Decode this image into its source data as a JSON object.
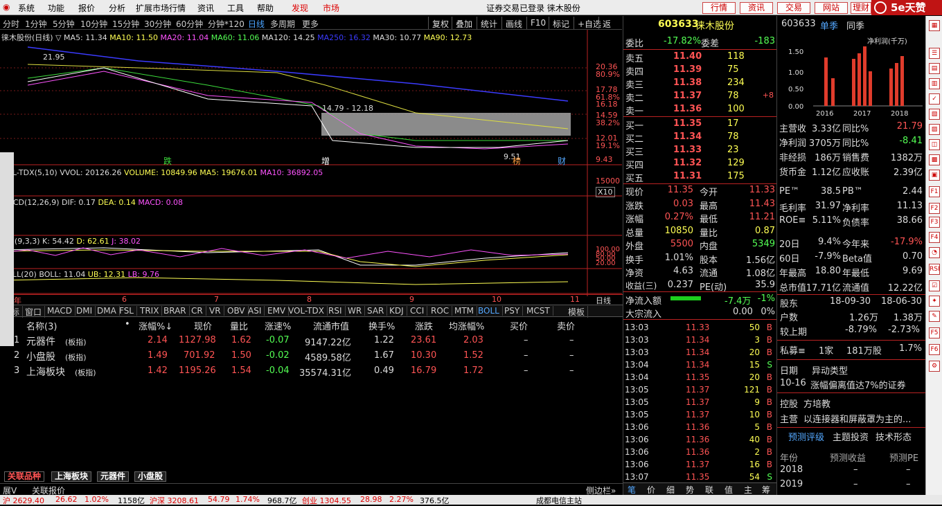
{
  "menubar": {
    "items": [
      "系统",
      "功能",
      "报价",
      "分析",
      "扩展市场行情",
      "资讯",
      "工具",
      "帮助",
      "发现",
      "市场"
    ],
    "center": "证券交易已登录 徕木股份",
    "buttons": [
      "行情",
      "资讯",
      "交易",
      "网站",
      "理财"
    ],
    "logo": "5e天赞"
  },
  "chart_toolbar": {
    "periods": [
      "分时",
      "1分钟",
      "5分钟",
      "10分钟",
      "15分钟",
      "30分钟",
      "60分钟",
      "分钟*120",
      "日线",
      "多周期",
      "更多"
    ],
    "selected": "日线",
    "actions": [
      "复权",
      "叠加",
      "统计",
      "画线",
      "F10",
      "标记",
      "+自选",
      "返回"
    ]
  },
  "ma_line": {
    "title": "徕木股份(日线) ▽",
    "ma5": "MA5: 11.34",
    "ma10": "MA10: 11.50",
    "ma20": "MA20: 11.04",
    "ma60": "MA60: 11.06",
    "ma120": "MA120: 14.25",
    "ma250": "MA250: 16.32",
    "ma30": "MA30: 10.77",
    "ma90": "MA90: 12.73"
  },
  "price_axis": [
    "20.36",
    "80.9%",
    "17.78",
    "61.8%",
    "16.18",
    "14.59",
    "38.2%",
    "12.01",
    "19.1%",
    "9.43"
  ],
  "price_marks": {
    "high": "21.95",
    "range": "14.79 - 12.18",
    "low": "9.51",
    "tags": [
      "跌",
      "增",
      "榜",
      "财"
    ]
  },
  "vol_line": {
    "title": "VOL-TDX(5,10)",
    "vvol": "VVOL: 20126.26",
    "volume": "VOLUME: 10849.96",
    "ma5": "MA5: 19676.01",
    "ma10": "MA10: 36892.05",
    "axis": "15000",
    "unit": "X10"
  },
  "macd_line": {
    "title": "MACD(12,26,9)",
    "dif": "DIF: 0.17",
    "dea": "DEA: 0.14",
    "macd": "MACD: 0.08"
  },
  "kdj_line": {
    "title": "KDJ(9,3,3)",
    "k": "K: 54.42",
    "d": "D: 62.61",
    "j": "J: 38.02",
    "axis": [
      "100.00",
      "80.00",
      "50.00",
      "20.00"
    ]
  },
  "boll_line": {
    "title": "BOLL(20)",
    "boll": "BOLL: 11.04",
    "ub": "UB: 12.31",
    "lb": "LB: 9.76"
  },
  "date_axis": [
    "18年",
    "6",
    "7",
    "8",
    "9",
    "10",
    "11"
  ],
  "date_period": "日线",
  "indicator_tabs": [
    "指标",
    "窗口",
    "MACD",
    "DMI",
    "DMA",
    "FSL",
    "TRIX",
    "BRAR",
    "CR",
    "VR",
    "OBV",
    "ASI",
    "EMV",
    "VOL-TDX",
    "RSI",
    "WR",
    "SAR",
    "KDJ",
    "CCI",
    "ROC",
    "MTM",
    "BOLL",
    "PSY",
    "MCST"
  ],
  "indicator_extra": "模板",
  "table": {
    "headers": [
      "名称(3)",
      "•",
      "涨幅%↓",
      "现价",
      "量比",
      "涨速%",
      "流通市值",
      "换手%",
      "涨跌",
      "均涨幅%",
      "买价",
      "卖价"
    ],
    "rows": [
      {
        "no": "1",
        "name": "元器件",
        "tag": "(板指)",
        "pct": "2.14",
        "price": "1127.98",
        "vr": "1.62",
        "speed": "-0.07",
        "mv": "9147.22亿",
        "turn": "1.22",
        "chg": "23.61",
        "avg": "2.03",
        "bid": "–",
        "ask": "–"
      },
      {
        "no": "2",
        "name": "小盘股",
        "tag": "(板指)",
        "pct": "1.49",
        "price": "701.92",
        "vr": "1.50",
        "speed": "-0.02",
        "mv": "4589.58亿",
        "turn": "1.67",
        "chg": "10.30",
        "avg": "1.52",
        "bid": "–",
        "ask": "–"
      },
      {
        "no": "3",
        "name": "上海板块",
        "tag": "(板指)",
        "pct": "1.42",
        "price": "1195.26",
        "vr": "1.54",
        "speed": "-0.04",
        "mv": "35574.31亿",
        "turn": "0.49",
        "chg": "16.79",
        "avg": "1.72",
        "bid": "–",
        "ask": "–"
      }
    ]
  },
  "sheets": [
    "关联品种",
    "上海板块",
    "元器件",
    "小盘股"
  ],
  "infobar": [
    "展V",
    "关联报价"
  ],
  "infobar_right": "侧边栏»",
  "quote": {
    "code": "603633",
    "name": "徕木股份",
    "wb_label": "委比",
    "wb": "-17.82%",
    "wc_label": "委差",
    "wc": "-183",
    "asks": [
      {
        "l": "卖五",
        "p": "11.40",
        "v": "118"
      },
      {
        "l": "卖四",
        "p": "11.39",
        "v": "75"
      },
      {
        "l": "卖三",
        "p": "11.38",
        "v": "234"
      },
      {
        "l": "卖二",
        "p": "11.37",
        "v": "78",
        "x": "+8"
      },
      {
        "l": "卖一",
        "p": "11.36",
        "v": "100"
      }
    ],
    "bids": [
      {
        "l": "买一",
        "p": "11.35",
        "v": "17"
      },
      {
        "l": "买二",
        "p": "11.34",
        "v": "78"
      },
      {
        "l": "买三",
        "p": "11.33",
        "v": "23"
      },
      {
        "l": "买四",
        "p": "11.32",
        "v": "129"
      },
      {
        "l": "买五",
        "p": "11.31",
        "v": "175"
      }
    ],
    "stats": [
      [
        "现价",
        "11.35",
        "今开",
        "11.33"
      ],
      [
        "涨跌",
        "0.03",
        "最高",
        "11.43"
      ],
      [
        "涨幅",
        "0.27%",
        "最低",
        "11.21"
      ],
      [
        "总量",
        "10850",
        "量比",
        "0.87"
      ],
      [
        "外盘",
        "5500",
        "内盘",
        "5349"
      ],
      [
        "换手",
        "1.01%",
        "股本",
        "1.56亿"
      ],
      [
        "净资",
        "4.63",
        "流通",
        "1.08亿"
      ],
      [
        "收益(三)",
        "0.237",
        "PE(动)",
        "35.9"
      ]
    ],
    "netflow": [
      "净流入额",
      "-7.4万",
      "-1%"
    ],
    "bigflow": [
      "大宗流入",
      "0.00",
      "0%"
    ],
    "ticks": [
      [
        "13:03",
        "11.33",
        "50",
        "B"
      ],
      [
        "13:03",
        "11.34",
        "3",
        "B"
      ],
      [
        "13:03",
        "11.34",
        "20",
        "B"
      ],
      [
        "13:04",
        "11.34",
        "15",
        "S"
      ],
      [
        "13:04",
        "11.35",
        "20",
        "B"
      ],
      [
        "13:05",
        "11.37",
        "121",
        "B"
      ],
      [
        "13:05",
        "11.37",
        "9",
        "B"
      ],
      [
        "13:05",
        "11.37",
        "10",
        "B"
      ],
      [
        "13:06",
        "11.36",
        "5",
        "B"
      ],
      [
        "13:06",
        "11.36",
        "40",
        "B"
      ],
      [
        "13:06",
        "11.36",
        "2",
        "B"
      ],
      [
        "13:06",
        "11.37",
        "16",
        "B"
      ],
      [
        "13:07",
        "11.35",
        "54",
        "S"
      ]
    ],
    "tabs": [
      "笔",
      "价",
      "细",
      "势",
      "联",
      "值",
      "主",
      "筹"
    ]
  },
  "f10": {
    "code": "603633",
    "tabs": [
      "单季",
      "同季"
    ],
    "chart_title": "净利润(千万)",
    "chart_yaxis": [
      "1.50",
      "1.00",
      "0.50",
      "0.00"
    ],
    "chart_years": [
      "2016",
      "2017",
      "2018"
    ],
    "rows": [
      [
        "主营收",
        "3.33亿",
        "同比%",
        "21.79"
      ],
      [
        "净利润",
        "3705万",
        "同比%",
        "-8.41"
      ],
      [
        "非经损",
        "186万",
        "销售费",
        "1382万"
      ],
      [
        "货币金",
        "1.12亿",
        "应收账",
        "2.39亿"
      ],
      [
        "PE™",
        "38.5",
        "PB™",
        "2.44"
      ],
      [
        "毛利率",
        "31.97",
        "净利率",
        "11.13"
      ],
      [
        "ROE≡",
        "5.11%",
        "负债率",
        "38.66"
      ],
      [
        "20日",
        "9.4%",
        "今年来",
        "-17.9%"
      ],
      [
        "60日",
        "-7.9%",
        "Beta值",
        "0.70"
      ],
      [
        "年最高",
        "18.80",
        "年最低",
        "9.69"
      ],
      [
        "总市值",
        "17.71亿",
        "流通值",
        "12.22亿"
      ]
    ],
    "holders": {
      "label": "股东",
      "d1": "18-09-30",
      "d2": "18-06-30",
      "r1": [
        "户数",
        "1.26万",
        "1.38万"
      ],
      "r2": [
        "较上期",
        "-8.79%",
        "-2.73%"
      ],
      "r3": [
        "私募≡",
        "1家",
        "181万股",
        "1.7%"
      ]
    },
    "events": {
      "h1": "日期",
      "h2": "异动类型",
      "date": "10-16",
      "text": "涨幅偏离值达7%的证券"
    },
    "ctrl": [
      "控股",
      "方培教"
    ],
    "biz": [
      "主营",
      "以连接器和屏蔽罩为主的..."
    ],
    "forecast_tabs": [
      "预测评级",
      "主题投资",
      "技术形态"
    ],
    "forecast_head": [
      "年份",
      "预测收益",
      "预测PE"
    ],
    "forecast_rows": [
      [
        "2018",
        "–",
        "–"
      ],
      [
        "2019",
        "–",
        "–"
      ]
    ]
  },
  "status": [
    "沪 2629.40",
    "26.62",
    "1.02%",
    "1158亿",
    "沪深 3208.61",
    "54.79",
    "1.74%",
    "968.7亿",
    "创业 1304.55",
    "28.98",
    "2.27%",
    "376.5亿",
    "成都电信主站"
  ]
}
